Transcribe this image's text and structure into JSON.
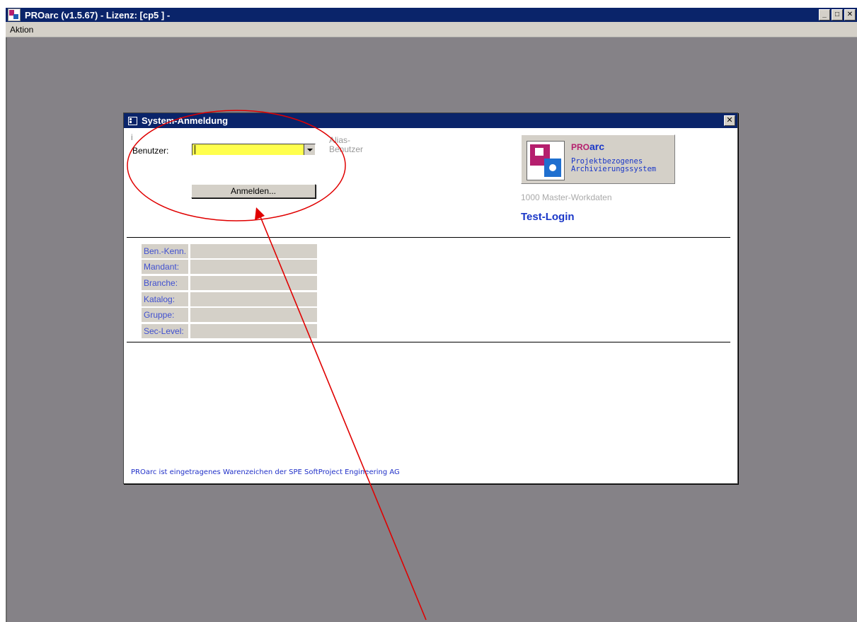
{
  "app": {
    "title": "PROarc  (v1.5.67)  - Lizenz: [cp5 ] -",
    "window_buttons": {
      "minimize": "_",
      "maximize": "□",
      "close": "✕"
    }
  },
  "menu": {
    "items": [
      {
        "label": "Aktion"
      }
    ]
  },
  "dialog": {
    "title": "System-Anmeldung",
    "close_label": "✕",
    "info_marker": "i",
    "user_label": "Benutzer:",
    "user_value": "",
    "alias_label": "Alias-\nBenutzer",
    "login_button": "Anmelden...",
    "logo": {
      "pro": "PRO",
      "arc": "arc",
      "line1": "Projektbezogenes",
      "line2": "Archivierungssystem"
    },
    "workdata": "1000 Master-Workdaten",
    "test_login": "Test-Login",
    "fields": [
      {
        "label": "Ben.-Kenn.",
        "value": ""
      },
      {
        "label": "Mandant:",
        "value": ""
      },
      {
        "label": "Branche:",
        "value": ""
      },
      {
        "label": "Katalog:",
        "value": ""
      },
      {
        "label": "Gruppe:",
        "value": ""
      },
      {
        "label": "Sec-Level:",
        "value": ""
      }
    ],
    "footer": "PROarc ist eingetragenes Warenzeichen der SPE SoftProject Engineering AG"
  },
  "colors": {
    "titlebar": "#0a246a",
    "workspace": "#858287",
    "input_highlight": "#ffff4d",
    "annotation": "#e00000",
    "link_blue": "#1a37c8"
  }
}
